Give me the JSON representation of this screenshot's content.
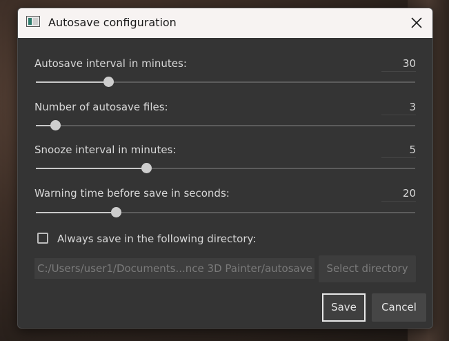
{
  "window": {
    "title": "Autosave configuration"
  },
  "settings": [
    {
      "label": "Autosave interval in minutes:",
      "value": "30",
      "slider_fraction": 0.19
    },
    {
      "label": "Number of autosave files:",
      "value": "3",
      "slider_fraction": 0.05
    },
    {
      "label": "Snooze interval in minutes:",
      "value": "5",
      "slider_fraction": 0.29
    },
    {
      "label": "Warning time before save in seconds:",
      "value": "20",
      "slider_fraction": 0.21
    }
  ],
  "directory": {
    "checkbox_label": "Always save in the following directory:",
    "checked": false,
    "path_value": "C:/Users/user1/Documents...nce 3D Painter/autosave/",
    "select_label": "Select directory"
  },
  "buttons": {
    "save": "Save",
    "cancel": "Cancel"
  }
}
